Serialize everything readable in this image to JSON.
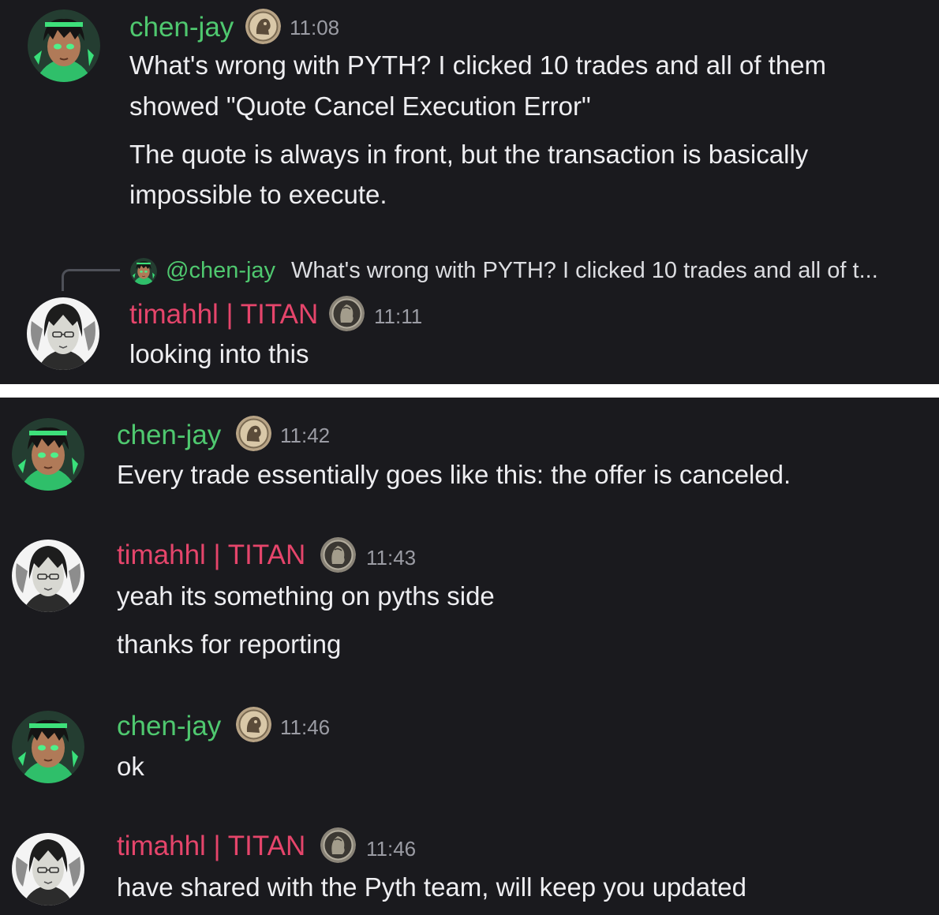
{
  "users": {
    "chen": {
      "name": "chen-jay",
      "color": "#4fc86f"
    },
    "tim": {
      "name": "timahhl | TITAN",
      "color": "#e5456b"
    }
  },
  "top": {
    "m1": {
      "time": "11:08",
      "lines": [
        "What's wrong with PYTH? I clicked 10 trades and all of them",
        "showed \"Quote Cancel Execution Error\"",
        "The quote is always in front, but the transaction is basically",
        "impossible to execute."
      ]
    },
    "reply": {
      "mention": "@chen-jay",
      "snippet": "What's wrong with PYTH? I clicked 10 trades and all of t..."
    },
    "m2": {
      "time": "11:11",
      "lines": [
        "looking into this"
      ]
    }
  },
  "bottom": {
    "m3": {
      "time": "11:42",
      "lines": [
        "Every trade essentially goes like this: the offer is canceled."
      ]
    },
    "m4": {
      "time": "11:43",
      "lines": [
        "yeah its something on pyths side",
        "thanks for reporting"
      ]
    },
    "m5": {
      "time": "11:46",
      "lines": [
        "ok"
      ]
    },
    "m6": {
      "time": "11:46",
      "lines": [
        "have shared with the Pyth team, will keep you updated"
      ]
    }
  },
  "icons": {
    "chen_avatar": "anime-avatar-green",
    "tim_avatar": "anime-avatar-grayscale",
    "chen_badge": "coin-badge-gold",
    "tim_badge": "coin-badge-dark"
  }
}
